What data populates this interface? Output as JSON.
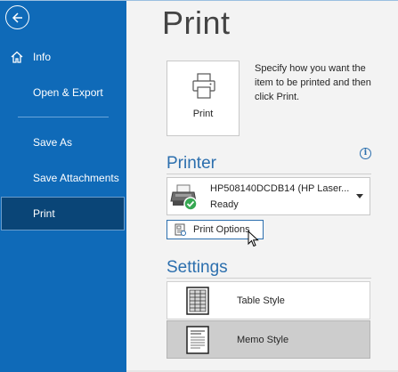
{
  "sidebar": {
    "back_icon": "back-arrow-icon",
    "items": [
      {
        "label": "Info",
        "icon": "home-icon"
      },
      {
        "label": "Open & Export"
      },
      {
        "label": "Save As"
      },
      {
        "label": "Save Attachments"
      },
      {
        "label": "Print",
        "selected": true
      }
    ],
    "background": "#0f6ab8",
    "selected_background": "#0a4577"
  },
  "main": {
    "title": "Print",
    "print_button": {
      "label": "Print",
      "icon": "printer-icon"
    },
    "print_description": "Specify how you want the item to be printed and then click Print.",
    "printer_section": {
      "heading": "Printer",
      "info_icon": "info-icon",
      "selected_printer": {
        "name": "HP508140DCDB14 (HP Laser...",
        "status": "Ready",
        "icon": "printer-ready-icon"
      },
      "options_button": {
        "label": "Print Options",
        "icon": "print-options-icon"
      }
    },
    "settings_section": {
      "heading": "Settings",
      "styles": [
        {
          "label": "Table Style",
          "icon": "table-style-icon",
          "selected": false
        },
        {
          "label": "Memo Style",
          "icon": "memo-style-icon",
          "selected": true
        }
      ]
    },
    "accent_color": "#2c6fae"
  }
}
